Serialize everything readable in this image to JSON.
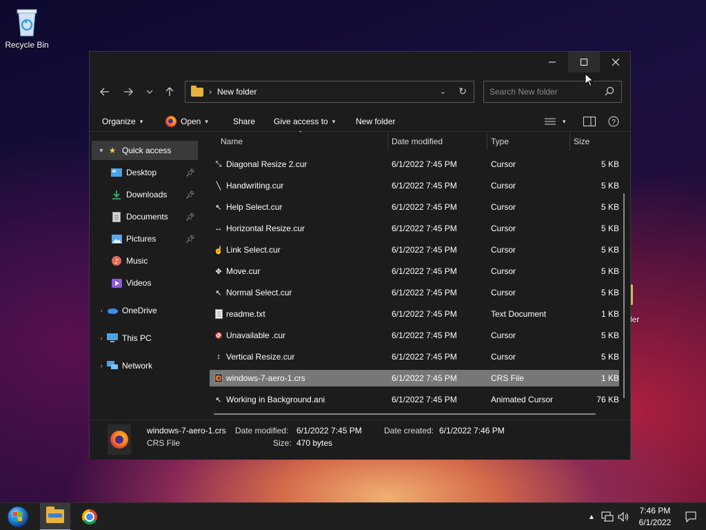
{
  "desktop": {
    "recycle_bin_label": "Recycle Bin",
    "partial_label": "ler"
  },
  "window": {
    "address": {
      "path": "New folder"
    },
    "search": {
      "placeholder": "Search New folder"
    },
    "commands": {
      "organize": "Organize",
      "open": "Open",
      "share": "Share",
      "give_access": "Give access to",
      "new_folder": "New folder"
    },
    "nav_pane": [
      {
        "label": "Quick access",
        "icon": "star-icon",
        "color": "#f2c94c",
        "selected": true
      },
      {
        "label": "Desktop",
        "icon": "desktop-icon",
        "color": "#4aa3e8",
        "pinned": true
      },
      {
        "label": "Downloads",
        "icon": "download-icon",
        "color": "#3fb27f",
        "pinned": true
      },
      {
        "label": "Documents",
        "icon": "documents-icon",
        "color": "#c8c8c8",
        "pinned": true
      },
      {
        "label": "Pictures",
        "icon": "pictures-icon",
        "color": "#5aa7e8",
        "pinned": true
      },
      {
        "label": "Music",
        "icon": "music-icon",
        "color": "#e06a5a"
      },
      {
        "label": "Videos",
        "icon": "videos-icon",
        "color": "#8a5ae0"
      },
      {
        "label": "OneDrive",
        "icon": "cloud-icon",
        "color": "#3a8ee6"
      },
      {
        "label": "This PC",
        "icon": "computer-icon",
        "color": "#4aa3e8"
      },
      {
        "label": "Network",
        "icon": "network-icon",
        "color": "#4aa3e8"
      }
    ],
    "columns": {
      "name": "Name",
      "date": "Date modified",
      "type": "Type",
      "size": "Size"
    },
    "files": [
      {
        "name": "Diagonal Resize 2.cur",
        "date": "6/1/2022 7:45 PM",
        "type": "Cursor",
        "size": "5 KB",
        "icon": "cursor-icon"
      },
      {
        "name": "Handwriting.cur",
        "date": "6/1/2022 7:45 PM",
        "type": "Cursor",
        "size": "5 KB",
        "icon": "cursor-icon"
      },
      {
        "name": "Help Select.cur",
        "date": "6/1/2022 7:45 PM",
        "type": "Cursor",
        "size": "5 KB",
        "icon": "cursor-icon"
      },
      {
        "name": "Horizontal Resize.cur",
        "date": "6/1/2022 7:45 PM",
        "type": "Cursor",
        "size": "5 KB",
        "icon": "cursor-icon"
      },
      {
        "name": "Link Select.cur",
        "date": "6/1/2022 7:45 PM",
        "type": "Cursor",
        "size": "5 KB",
        "icon": "cursor-icon"
      },
      {
        "name": "Move.cur",
        "date": "6/1/2022 7:45 PM",
        "type": "Cursor",
        "size": "5 KB",
        "icon": "cursor-icon"
      },
      {
        "name": "Normal Select.cur",
        "date": "6/1/2022 7:45 PM",
        "type": "Cursor",
        "size": "5 KB",
        "icon": "cursor-icon"
      },
      {
        "name": "readme.txt",
        "date": "6/1/2022 7:45 PM",
        "type": "Text Document",
        "size": "1 KB",
        "icon": "text-file-icon"
      },
      {
        "name": "Unavailable .cur",
        "date": "6/1/2022 7:45 PM",
        "type": "Cursor",
        "size": "5 KB",
        "icon": "cursor-icon"
      },
      {
        "name": "Vertical Resize.cur",
        "date": "6/1/2022 7:45 PM",
        "type": "Cursor",
        "size": "5 KB",
        "icon": "cursor-icon"
      },
      {
        "name": "windows-7-aero-1.crs",
        "date": "6/1/2022 7:45 PM",
        "type": "CRS File",
        "size": "1 KB",
        "icon": "firefox-file-icon",
        "selected": true
      },
      {
        "name": "Working in Background.ani",
        "date": "6/1/2022 7:45 PM",
        "type": "Animated Cursor",
        "size": "76 KB",
        "icon": "cursor-icon"
      }
    ],
    "details": {
      "filename": "windows-7-aero-1.crs",
      "filetype": "CRS File",
      "modified_label": "Date modified:",
      "modified_value": "6/1/2022 7:45 PM",
      "size_label": "Size:",
      "size_value": "470 bytes",
      "created_label": "Date created:",
      "created_value": "6/1/2022 7:46 PM"
    }
  },
  "taskbar": {
    "time": "7:46 PM",
    "date": "6/1/2022"
  }
}
